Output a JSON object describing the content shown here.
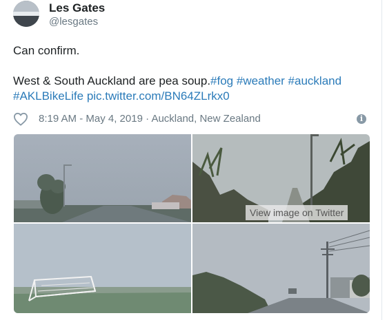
{
  "author": {
    "name": "Les Gates",
    "handle": "@lesgates"
  },
  "tweet": {
    "line1": "Can confirm.",
    "line2_text": "West & South Auckland are pea soup.",
    "hashtags": [
      "#fog",
      "#weather",
      "#auckland",
      "#AKLBikeLife"
    ],
    "link": "pic.twitter.com/BN64ZLrkx0"
  },
  "meta": {
    "timestamp": "8:19 AM - May 4, 2019",
    "separator": "·",
    "location": "Auckland, New Zealand"
  },
  "icons": {
    "like": "heart-outline-icon",
    "info": "info-icon"
  },
  "media": {
    "view_label": "View image on Twitter",
    "photos": [
      "foggy-road-with-trees",
      "foggy-path-with-shrubs",
      "foggy-football-field-goal",
      "foggy-street-with-power-pole"
    ]
  },
  "colors": {
    "link": "#2b7bb9",
    "meta": "#697882",
    "text": "#1c2022"
  }
}
